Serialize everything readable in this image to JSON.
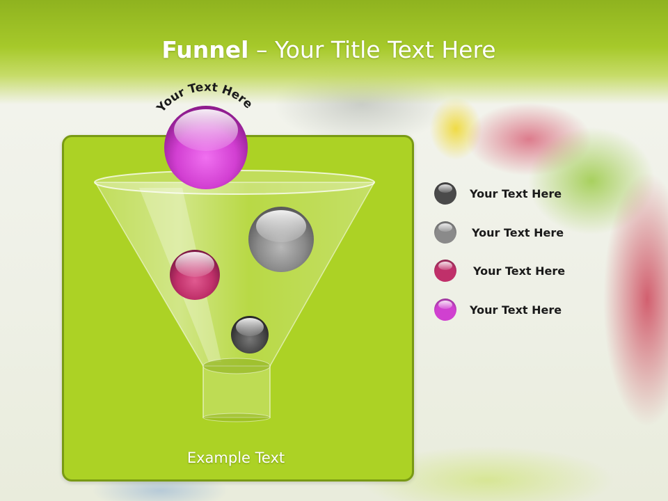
{
  "slide": {
    "title_bold": "Funnel",
    "title_rest": " – Your Title Text Here",
    "arc_text": "Your Text Here",
    "example_text": "Example Text"
  },
  "legend": [
    {
      "label": "Your  Text Here",
      "color": "#4a4a4a"
    },
    {
      "label": "Your  Text Here",
      "color": "#8a8a8a"
    },
    {
      "label": "Your  Text Here",
      "color": "#c0306a"
    },
    {
      "label": "Your  Text Here",
      "color": "#d040d0"
    }
  ],
  "colors": {
    "header": "#a6c92a",
    "panel": "#acd225",
    "panel_border": "#799a14"
  }
}
